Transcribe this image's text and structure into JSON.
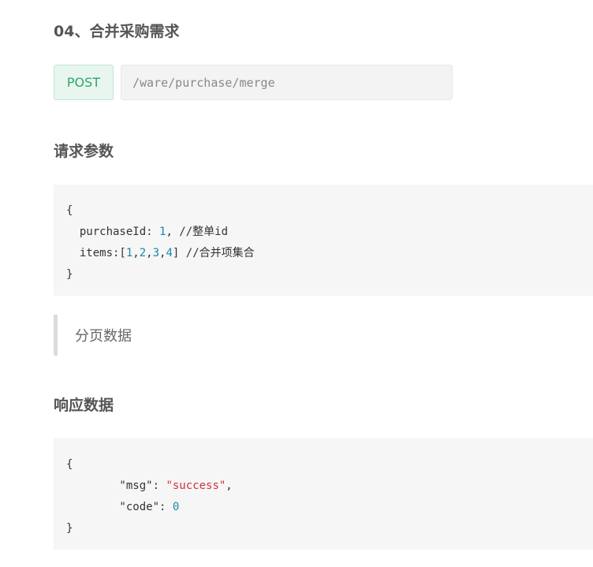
{
  "section": {
    "title": "04、合并采购需求"
  },
  "endpoint": {
    "method": "POST",
    "url": "/ware/purchase/merge"
  },
  "request": {
    "heading": "请求参数",
    "code": {
      "open": "{",
      "line1_key": "  purchaseId: ",
      "line1_num": "1",
      "line1_rest": ", //整单id",
      "line2_key": "  items:[",
      "line2_n1": "1",
      "line2_n2": "2",
      "line2_n3": "3",
      "line2_n4": "4",
      "line2_rest": "] //合并项集合",
      "close": "}"
    }
  },
  "note": {
    "text": "分页数据"
  },
  "response": {
    "heading": "响应数据",
    "code": {
      "open": "{",
      "line1_key": "        \"msg\": ",
      "line1_str": "\"success\"",
      "line1_end": ",",
      "line2_key": "        \"code\": ",
      "line2_num": "0",
      "close": "}"
    }
  }
}
